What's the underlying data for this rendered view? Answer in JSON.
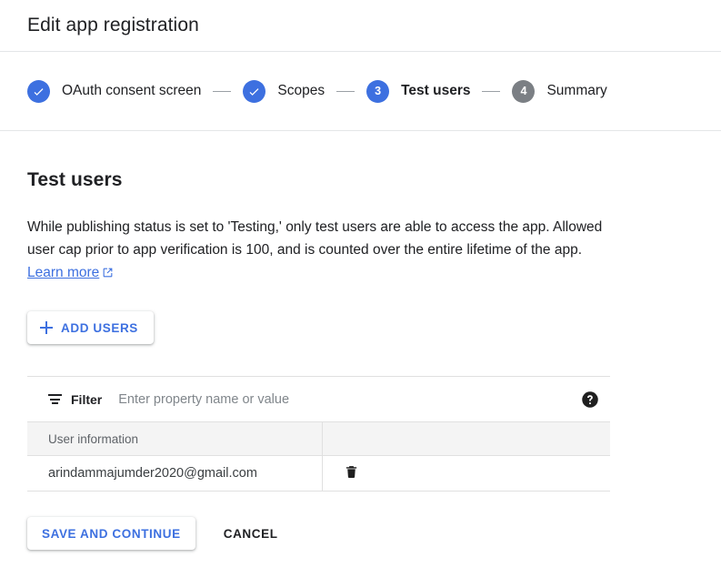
{
  "header": {
    "title": "Edit app registration"
  },
  "stepper": {
    "steps": [
      {
        "label": "OAuth consent screen",
        "state": "done",
        "number": "1",
        "icon": "check-icon"
      },
      {
        "label": "Scopes",
        "state": "done",
        "number": "2",
        "icon": "check-icon"
      },
      {
        "label": "Test users",
        "state": "active",
        "number": "3",
        "icon": ""
      },
      {
        "label": "Summary",
        "state": "todo",
        "number": "4",
        "icon": ""
      }
    ]
  },
  "main": {
    "section_title": "Test users",
    "description_part1": "While publishing status is set to 'Testing,' only test users are able to access the app. Allowed user cap prior to app verification is 100, and is counted over the entire lifetime of the app. ",
    "learn_more_label": "Learn more",
    "learn_more_icon": "external-link-icon",
    "add_users_label": "ADD USERS",
    "add_users_icon": "plus-icon"
  },
  "filter": {
    "icon": "filter-icon",
    "label": "Filter",
    "placeholder": "Enter property name or value",
    "value": "",
    "help_icon": "help-icon"
  },
  "table": {
    "columns": [
      "User information",
      ""
    ],
    "rows": [
      {
        "user": "arindammajumder2020@gmail.com",
        "delete_icon": "trash-icon"
      }
    ]
  },
  "footer": {
    "save_label": "SAVE AND CONTINUE",
    "cancel_label": "CANCEL"
  },
  "colors": {
    "accent_blue": "#3d70e0",
    "step_todo_gray": "#7b7f84",
    "divider": "#e0e0e0",
    "header_row_bg": "#f4f4f4",
    "placeholder_gray": "#80868b"
  }
}
